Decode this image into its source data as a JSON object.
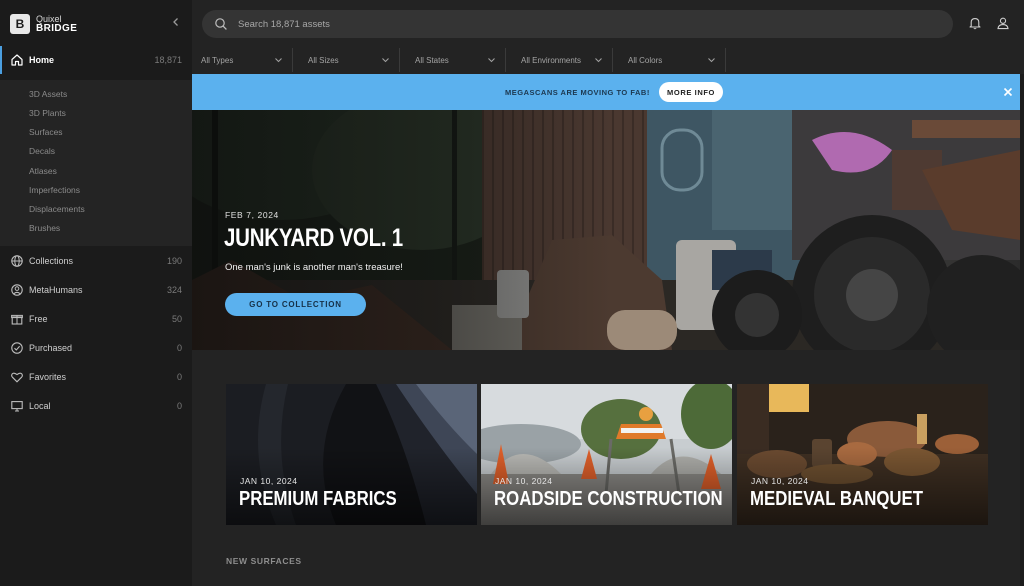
{
  "brand": {
    "line1": "Quixel",
    "line2": "BRIDGE",
    "logo_letter": "B"
  },
  "sidebar": {
    "home": {
      "label": "Home",
      "count": "18,871",
      "icon": "home-icon"
    },
    "sub_items": [
      "3D Assets",
      "3D Plants",
      "Surfaces",
      "Decals",
      "Atlases",
      "Imperfections",
      "Displacements",
      "Brushes"
    ],
    "items": [
      {
        "label": "Collections",
        "count": "190",
        "icon": "globe-icon"
      },
      {
        "label": "MetaHumans",
        "count": "324",
        "icon": "person-circle-icon"
      },
      {
        "label": "Free",
        "count": "50",
        "icon": "gift-icon"
      },
      {
        "label": "Purchased",
        "count": "0",
        "icon": "check-circle-icon"
      },
      {
        "label": "Favorites",
        "count": "0",
        "icon": "heart-icon"
      },
      {
        "label": "Local",
        "count": "0",
        "icon": "monitor-icon"
      }
    ]
  },
  "search": {
    "placeholder": "Search 18,871 assets"
  },
  "filters": [
    "All Types",
    "All Sizes",
    "All States",
    "All Environments",
    "All Colors"
  ],
  "banner": {
    "text": "MEGASCANS ARE MOVING TO FAB!",
    "button": "MORE INFO"
  },
  "hero": {
    "date": "FEB 7, 2024",
    "title": "JUNKYARD VOL. 1",
    "subtitle": "One man's junk is another man's treasure!",
    "button": "GO TO COLLECTION"
  },
  "cards": [
    {
      "date": "JAN 10, 2024",
      "title": "PREMIUM FABRICS"
    },
    {
      "date": "JAN 10, 2024",
      "title": "ROADSIDE CONSTRUCTION"
    },
    {
      "date": "JAN 10, 2024",
      "title": "MEDIEVAL BANQUET"
    }
  ],
  "section": {
    "title": "NEW SURFACES"
  },
  "colors": {
    "accent": "#5bb1ee",
    "sidebar": "#1b1b1b",
    "background": "#232323"
  }
}
